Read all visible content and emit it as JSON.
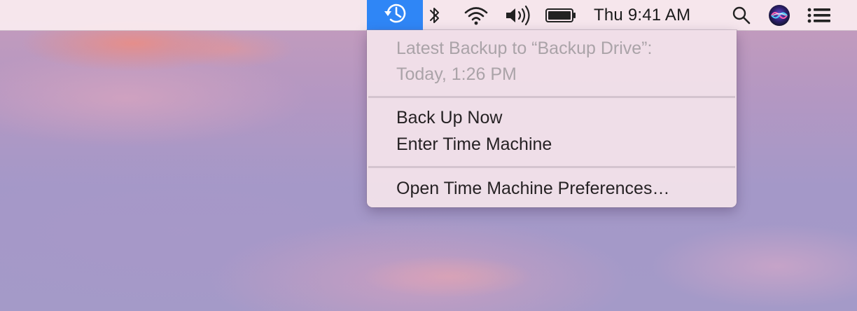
{
  "menubar": {
    "time_machine_icon": "time-machine-icon",
    "bluetooth_icon": "bluetooth-icon",
    "wifi_icon": "wifi-icon",
    "volume_icon": "volume-icon",
    "battery_icon": "battery-icon",
    "clock": "Thu 9:41 AM",
    "search_icon": "spotlight-search-icon",
    "siri_icon": "siri-icon",
    "notification_icon": "notification-center-icon",
    "accent_color": "#2f86f6"
  },
  "menu": {
    "info_line1": "Latest Backup to “Backup Drive”:",
    "info_line2": "Today, 1:26 PM",
    "items": [
      {
        "label": "Back Up Now"
      },
      {
        "label": "Enter Time Machine"
      },
      {
        "label": "Open Time Machine Preferences…"
      }
    ]
  }
}
